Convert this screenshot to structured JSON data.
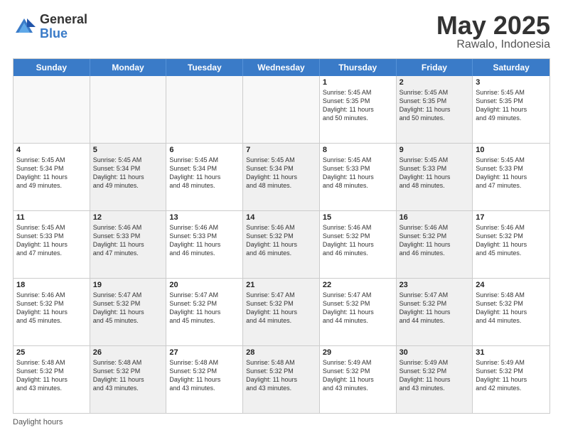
{
  "header": {
    "logo_general": "General",
    "logo_blue": "Blue",
    "title": "May 2025",
    "location": "Rawalo, Indonesia"
  },
  "days_of_week": [
    "Sunday",
    "Monday",
    "Tuesday",
    "Wednesday",
    "Thursday",
    "Friday",
    "Saturday"
  ],
  "footer_label": "Daylight hours",
  "weeks": [
    [
      {
        "day": "",
        "text": "",
        "empty": true
      },
      {
        "day": "",
        "text": "",
        "empty": true
      },
      {
        "day": "",
        "text": "",
        "empty": true
      },
      {
        "day": "",
        "text": "",
        "empty": true
      },
      {
        "day": "1",
        "text": "Sunrise: 5:45 AM\nSunset: 5:35 PM\nDaylight: 11 hours\nand 50 minutes.",
        "shaded": false
      },
      {
        "day": "2",
        "text": "Sunrise: 5:45 AM\nSunset: 5:35 PM\nDaylight: 11 hours\nand 50 minutes.",
        "shaded": true
      },
      {
        "day": "3",
        "text": "Sunrise: 5:45 AM\nSunset: 5:35 PM\nDaylight: 11 hours\nand 49 minutes.",
        "shaded": false
      }
    ],
    [
      {
        "day": "4",
        "text": "Sunrise: 5:45 AM\nSunset: 5:34 PM\nDaylight: 11 hours\nand 49 minutes.",
        "shaded": false
      },
      {
        "day": "5",
        "text": "Sunrise: 5:45 AM\nSunset: 5:34 PM\nDaylight: 11 hours\nand 49 minutes.",
        "shaded": true
      },
      {
        "day": "6",
        "text": "Sunrise: 5:45 AM\nSunset: 5:34 PM\nDaylight: 11 hours\nand 48 minutes.",
        "shaded": false
      },
      {
        "day": "7",
        "text": "Sunrise: 5:45 AM\nSunset: 5:34 PM\nDaylight: 11 hours\nand 48 minutes.",
        "shaded": true
      },
      {
        "day": "8",
        "text": "Sunrise: 5:45 AM\nSunset: 5:33 PM\nDaylight: 11 hours\nand 48 minutes.",
        "shaded": false
      },
      {
        "day": "9",
        "text": "Sunrise: 5:45 AM\nSunset: 5:33 PM\nDaylight: 11 hours\nand 48 minutes.",
        "shaded": true
      },
      {
        "day": "10",
        "text": "Sunrise: 5:45 AM\nSunset: 5:33 PM\nDaylight: 11 hours\nand 47 minutes.",
        "shaded": false
      }
    ],
    [
      {
        "day": "11",
        "text": "Sunrise: 5:45 AM\nSunset: 5:33 PM\nDaylight: 11 hours\nand 47 minutes.",
        "shaded": false
      },
      {
        "day": "12",
        "text": "Sunrise: 5:46 AM\nSunset: 5:33 PM\nDaylight: 11 hours\nand 47 minutes.",
        "shaded": true
      },
      {
        "day": "13",
        "text": "Sunrise: 5:46 AM\nSunset: 5:33 PM\nDaylight: 11 hours\nand 46 minutes.",
        "shaded": false
      },
      {
        "day": "14",
        "text": "Sunrise: 5:46 AM\nSunset: 5:32 PM\nDaylight: 11 hours\nand 46 minutes.",
        "shaded": true
      },
      {
        "day": "15",
        "text": "Sunrise: 5:46 AM\nSunset: 5:32 PM\nDaylight: 11 hours\nand 46 minutes.",
        "shaded": false
      },
      {
        "day": "16",
        "text": "Sunrise: 5:46 AM\nSunset: 5:32 PM\nDaylight: 11 hours\nand 46 minutes.",
        "shaded": true
      },
      {
        "day": "17",
        "text": "Sunrise: 5:46 AM\nSunset: 5:32 PM\nDaylight: 11 hours\nand 45 minutes.",
        "shaded": false
      }
    ],
    [
      {
        "day": "18",
        "text": "Sunrise: 5:46 AM\nSunset: 5:32 PM\nDaylight: 11 hours\nand 45 minutes.",
        "shaded": false
      },
      {
        "day": "19",
        "text": "Sunrise: 5:47 AM\nSunset: 5:32 PM\nDaylight: 11 hours\nand 45 minutes.",
        "shaded": true
      },
      {
        "day": "20",
        "text": "Sunrise: 5:47 AM\nSunset: 5:32 PM\nDaylight: 11 hours\nand 45 minutes.",
        "shaded": false
      },
      {
        "day": "21",
        "text": "Sunrise: 5:47 AM\nSunset: 5:32 PM\nDaylight: 11 hours\nand 44 minutes.",
        "shaded": true
      },
      {
        "day": "22",
        "text": "Sunrise: 5:47 AM\nSunset: 5:32 PM\nDaylight: 11 hours\nand 44 minutes.",
        "shaded": false
      },
      {
        "day": "23",
        "text": "Sunrise: 5:47 AM\nSunset: 5:32 PM\nDaylight: 11 hours\nand 44 minutes.",
        "shaded": true
      },
      {
        "day": "24",
        "text": "Sunrise: 5:48 AM\nSunset: 5:32 PM\nDaylight: 11 hours\nand 44 minutes.",
        "shaded": false
      }
    ],
    [
      {
        "day": "25",
        "text": "Sunrise: 5:48 AM\nSunset: 5:32 PM\nDaylight: 11 hours\nand 43 minutes.",
        "shaded": false
      },
      {
        "day": "26",
        "text": "Sunrise: 5:48 AM\nSunset: 5:32 PM\nDaylight: 11 hours\nand 43 minutes.",
        "shaded": true
      },
      {
        "day": "27",
        "text": "Sunrise: 5:48 AM\nSunset: 5:32 PM\nDaylight: 11 hours\nand 43 minutes.",
        "shaded": false
      },
      {
        "day": "28",
        "text": "Sunrise: 5:48 AM\nSunset: 5:32 PM\nDaylight: 11 hours\nand 43 minutes.",
        "shaded": true
      },
      {
        "day": "29",
        "text": "Sunrise: 5:49 AM\nSunset: 5:32 PM\nDaylight: 11 hours\nand 43 minutes.",
        "shaded": false
      },
      {
        "day": "30",
        "text": "Sunrise: 5:49 AM\nSunset: 5:32 PM\nDaylight: 11 hours\nand 43 minutes.",
        "shaded": true
      },
      {
        "day": "31",
        "text": "Sunrise: 5:49 AM\nSunset: 5:32 PM\nDaylight: 11 hours\nand 42 minutes.",
        "shaded": false
      }
    ]
  ]
}
